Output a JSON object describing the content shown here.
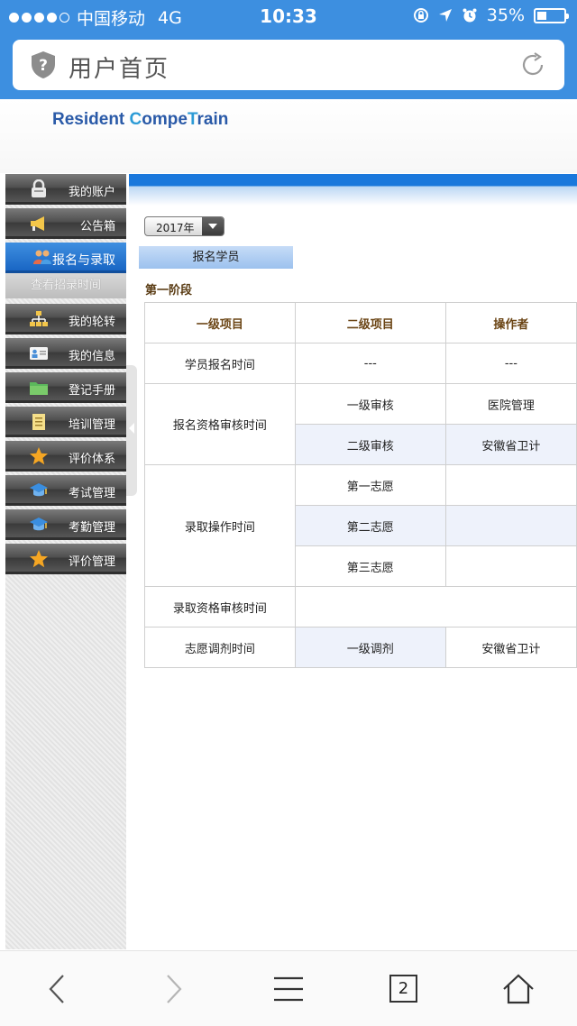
{
  "status_bar": {
    "carrier": "中国移动",
    "network": "4G",
    "time": "10:33",
    "battery": "35%",
    "battery_level": 0.35
  },
  "browser": {
    "page_title": "用户首页",
    "tab_count": "2"
  },
  "site": {
    "logo_parts": [
      "R",
      "esident ",
      "C",
      "ompe",
      "T",
      "rain"
    ]
  },
  "sidebar": {
    "items": [
      {
        "label": "我的账户",
        "icon": "lock-icon"
      },
      {
        "label": "公告箱",
        "icon": "megaphone-icon"
      },
      {
        "label": "报名与录取",
        "icon": "people-icon",
        "active": true
      },
      {
        "label": "我的轮转",
        "icon": "org-chart-icon"
      },
      {
        "label": "我的信息",
        "icon": "id-card-icon"
      },
      {
        "label": "登记手册",
        "icon": "folder-icon"
      },
      {
        "label": "培训管理",
        "icon": "notepad-icon"
      },
      {
        "label": "评价体系",
        "icon": "star-icon"
      },
      {
        "label": "考试管理",
        "icon": "graduation-cap-icon"
      },
      {
        "label": "考勤管理",
        "icon": "graduation-cap-icon"
      },
      {
        "label": "评价管理",
        "icon": "star-icon"
      }
    ],
    "sub_item": "查看招录时间"
  },
  "main": {
    "year_select": "2017年",
    "tab_label": "报名学员",
    "stage_title": "第一阶段",
    "table": {
      "headers": [
        "一级项目",
        "二级项目",
        "操作者"
      ],
      "rows": {
        "r1": {
          "c1": "学员报名时间",
          "c2": "---",
          "c3": "---"
        },
        "r2": {
          "c1": "报名资格审核时间",
          "c2a": "一级审核",
          "c3a": "医院管理",
          "c2b": "二级审核",
          "c3b": "安徽省卫计"
        },
        "r3": {
          "c1": "录取操作时间",
          "c2a": "第一志愿",
          "c2b": "第二志愿",
          "c2c": "第三志愿"
        },
        "r4": {
          "c1": "录取资格审核时间"
        },
        "r5": {
          "c1": "志愿调剂时间",
          "c2": "一级调剂",
          "c3": "安徽省卫计"
        }
      }
    }
  },
  "colors": {
    "brand_blue": "#3d8fe0",
    "active_menu": "#1966c4",
    "header_text": "#6b4515"
  }
}
